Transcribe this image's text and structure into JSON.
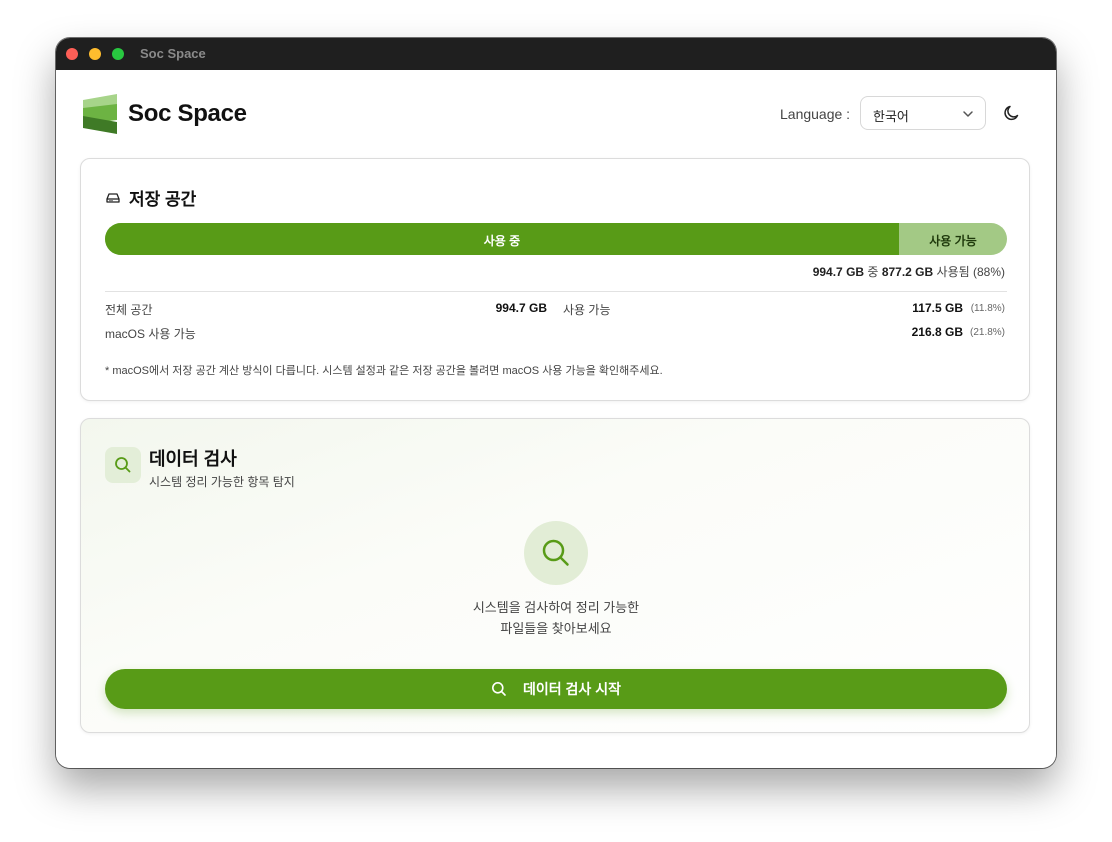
{
  "window": {
    "title": "Soc Space"
  },
  "header": {
    "app_name": "Soc Space",
    "language_label": "Language :",
    "language_value": "한국어",
    "theme_icon": "moon-icon"
  },
  "storage": {
    "title": "저장 공간",
    "icon": "hard-drive-icon",
    "bar": {
      "used_label": "사용 중",
      "available_label": "사용 가능",
      "used_fraction": 0.88,
      "used_color": "#589b17",
      "available_color": "#a3c985"
    },
    "summary": {
      "total": "994.7 GB",
      "middle": "중",
      "used": "877.2 GB",
      "suffix": "사용됨 (88%)"
    },
    "stats": {
      "total_label": "전체 공간",
      "total_value": "994.7 GB",
      "available_label": "사용 가능",
      "available_value": "117.5 GB",
      "available_pct": "(11.8%)",
      "macos_label": "macOS 사용 가능",
      "macos_value": "216.8 GB",
      "macos_pct": "(21.8%)"
    },
    "note": "* macOS에서 저장 공간 계산 방식이 다릅니다. 시스템 설정과 같은 저장 공간을 볼려면 macOS 사용 가능을 확인해주세요."
  },
  "scan": {
    "title": "데이터 검사",
    "subtitle": "시스템 정리 가능한 항목 탐지",
    "message_line1": "시스템을 검사하여 정리 가능한",
    "message_line2": "파일들을 찾아보세요",
    "start_button": "데이터 검사 시작",
    "icon": "search-icon"
  },
  "colors": {
    "accent": "#589b17",
    "accent_light": "#a3c985",
    "titlebar": "#1f1f1f"
  }
}
